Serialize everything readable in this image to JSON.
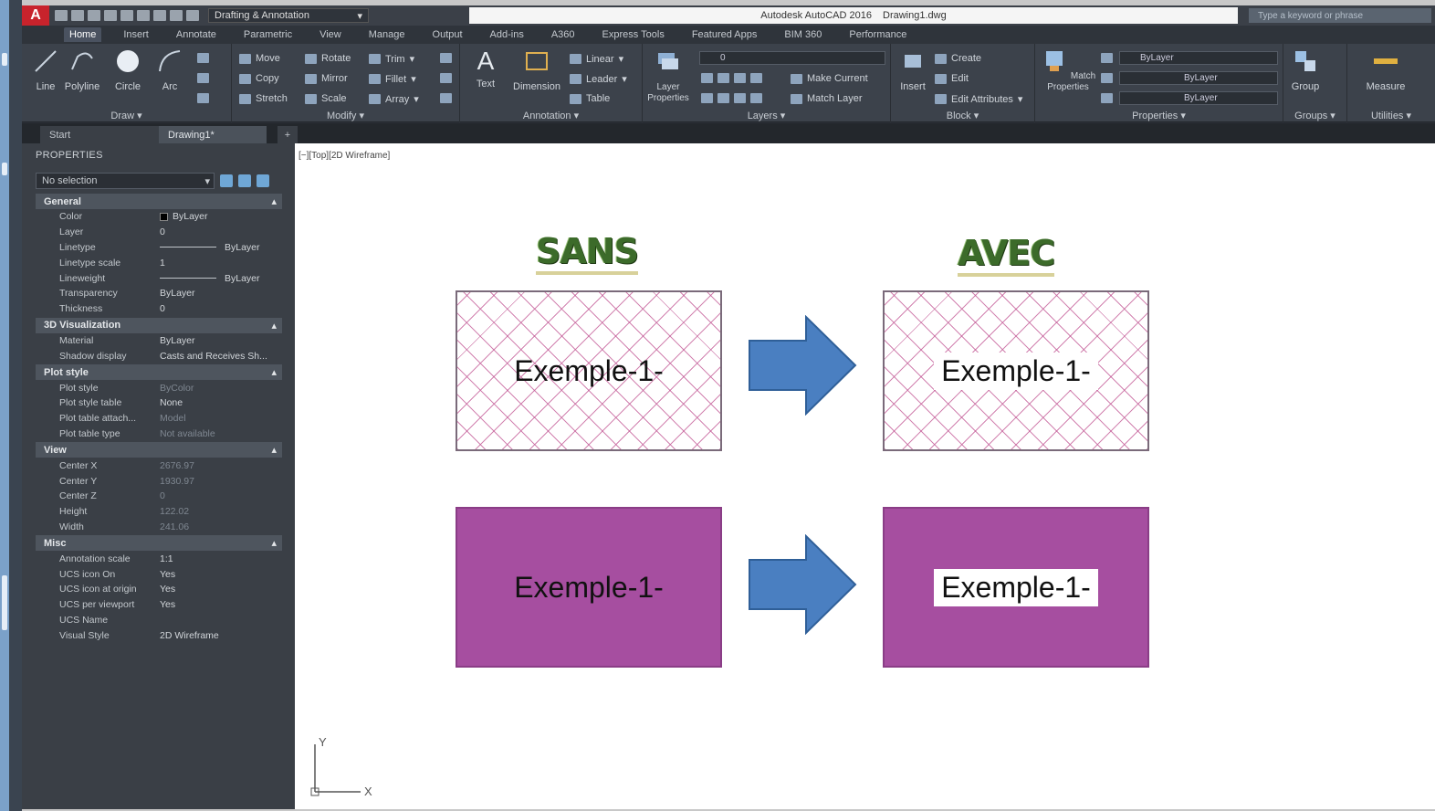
{
  "title_bar": {
    "logo": "A",
    "workspace": "Drafting & Annotation",
    "app_title": "Autodesk AutoCAD 2016",
    "file_name": "Drawing1.dwg",
    "search_placeholder": "Type a keyword or phrase"
  },
  "ribbon_tabs": [
    "Home",
    "Insert",
    "Annotate",
    "Parametric",
    "View",
    "Manage",
    "Output",
    "Add-ins",
    "A360",
    "Express Tools",
    "Featured Apps",
    "BIM 360",
    "Performance"
  ],
  "ribbon": {
    "draw": {
      "title": "Draw",
      "tools": [
        "Line",
        "Polyline",
        "Circle",
        "Arc"
      ]
    },
    "modify": {
      "title": "Modify",
      "tools": [
        "Move",
        "Rotate",
        "Trim",
        "Copy",
        "Mirror",
        "Fillet",
        "Stretch",
        "Scale",
        "Array"
      ]
    },
    "annotation": {
      "title": "Annotation",
      "tools": [
        "Text",
        "Dimension",
        "Linear",
        "Leader",
        "Table"
      ]
    },
    "layers": {
      "title": "Layers",
      "layer_properties": "Layer Properties",
      "current_layer": "0",
      "tools": [
        "Make Current",
        "Match Layer"
      ]
    },
    "block": {
      "title": "Block",
      "insert": "Insert",
      "tools": [
        "Create",
        "Edit",
        "Edit Attributes"
      ]
    },
    "properties": {
      "title": "Properties",
      "match": "Match Properties",
      "combos": [
        "ByLayer",
        "ByLayer",
        "ByLayer"
      ]
    },
    "groups": {
      "title": "Groups",
      "group": "Group"
    },
    "utilities": {
      "title": "Utilities",
      "measure": "Measure"
    }
  },
  "doc_tabs": {
    "start": "Start",
    "drawing": "Drawing1*",
    "plus": "+"
  },
  "properties_palette": {
    "header": "PROPERTIES",
    "selection": "No selection",
    "sections": [
      {
        "name": "General",
        "rows": [
          {
            "key": "Color",
            "value": "ByLayer"
          },
          {
            "key": "Layer",
            "value": "0"
          },
          {
            "key": "Linetype",
            "value": "ByLayer"
          },
          {
            "key": "Linetype scale",
            "value": "1"
          },
          {
            "key": "Lineweight",
            "value": "ByLayer"
          },
          {
            "key": "Transparency",
            "value": "ByLayer"
          },
          {
            "key": "Thickness",
            "value": "0"
          }
        ]
      },
      {
        "name": "3D Visualization",
        "rows": [
          {
            "key": "Material",
            "value": "ByLayer"
          },
          {
            "key": "Shadow display",
            "value": "Casts and Receives Sh..."
          }
        ]
      },
      {
        "name": "Plot style",
        "rows": [
          {
            "key": "Plot style",
            "value": "ByColor"
          },
          {
            "key": "Plot style table",
            "value": "None"
          },
          {
            "key": "Plot table attach...",
            "value": "Model"
          },
          {
            "key": "Plot table type",
            "value": "Not available"
          }
        ]
      },
      {
        "name": "View",
        "rows": [
          {
            "key": "Center X",
            "value": "2676.97"
          },
          {
            "key": "Center Y",
            "value": "1930.97"
          },
          {
            "key": "Center Z",
            "value": "0"
          },
          {
            "key": "Height",
            "value": "122.02"
          },
          {
            "key": "Width",
            "value": "241.06"
          }
        ]
      },
      {
        "name": "Misc",
        "rows": [
          {
            "key": "Annotation scale",
            "value": "1:1"
          },
          {
            "key": "UCS icon On",
            "value": "Yes"
          },
          {
            "key": "UCS icon at origin",
            "value": "Yes"
          },
          {
            "key": "UCS per viewport",
            "value": "Yes"
          },
          {
            "key": "UCS Name",
            "value": ""
          },
          {
            "key": "Visual Style",
            "value": "2D Wireframe"
          }
        ]
      }
    ]
  },
  "canvas": {
    "viewport_label": "[−][Top][2D Wireframe]",
    "heading_left": "SANS",
    "heading_right": "AVEC",
    "box_text": "Exemple-1-",
    "colors": {
      "hatch": "#c35a96",
      "solid_fill": "#a64ea0",
      "arrow": "#4a7fc1",
      "heading": "#3c6b2a"
    },
    "ucs_x": "X",
    "ucs_y": "Y"
  }
}
